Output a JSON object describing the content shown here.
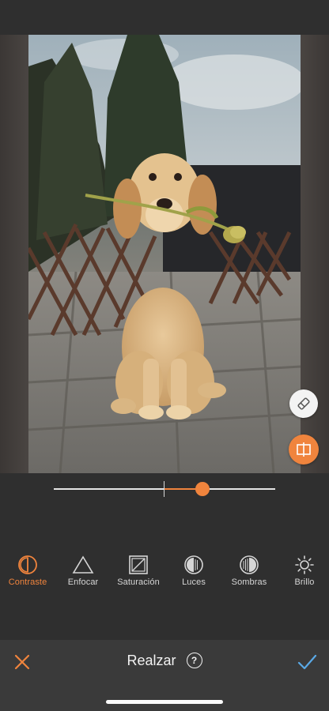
{
  "colors": {
    "accent": "#f0843d",
    "background": "#2f2f2f",
    "bottom_bar": "#3a3a3a",
    "icon_inactive": "#d6d6d6",
    "confirm": "#5aa9e6"
  },
  "slider": {
    "value_fraction": 0.67
  },
  "tools": [
    {
      "label": "Contraste",
      "icon": "contrast-icon",
      "active": true
    },
    {
      "label": "Enfocar",
      "icon": "sharpen-triangle-icon",
      "active": false
    },
    {
      "label": "Saturación",
      "icon": "saturation-icon",
      "active": false
    },
    {
      "label": "Luces",
      "icon": "highlights-icon",
      "active": false
    },
    {
      "label": "Sombras",
      "icon": "shadows-icon",
      "active": false
    },
    {
      "label": "Brillo",
      "icon": "brightness-sun-icon",
      "active": false
    }
  ],
  "bottom_bar": {
    "title": "Realzar",
    "help_symbol": "?",
    "cancel_icon": "close-icon",
    "confirm_icon": "checkmark-icon"
  },
  "photo": {
    "subject": "golden retriever puppy with tulip"
  },
  "side_buttons": {
    "eraser_icon": "eraser-icon",
    "compare_icon": "compare-icon"
  }
}
